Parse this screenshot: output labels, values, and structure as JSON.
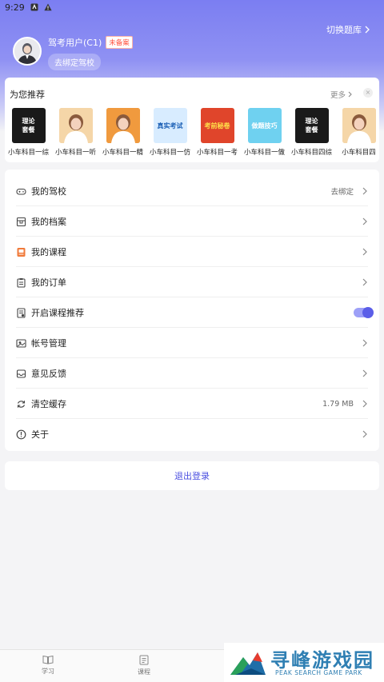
{
  "status_bar": {
    "time": "9:29"
  },
  "header": {
    "switch_bank_label": "切换题库",
    "user_name": "驾考用户(C1)",
    "badge": "未备案",
    "bind_school_label": "去绑定驾校"
  },
  "recommend": {
    "title": "为您推荐",
    "more_label": "更多",
    "close_label": "×",
    "items": [
      {
        "label": "小车科目一综",
        "thumb_text": "理论\n套餐",
        "bg": "#1a1a1a",
        "fg": "#ffffff"
      },
      {
        "label": "小车科目一听",
        "thumb_text": "",
        "bg": "#f5d6a8",
        "fg": "#ffffff"
      },
      {
        "label": "小车科目一精",
        "thumb_text": "",
        "bg": "#f09a3e",
        "fg": "#ffffff"
      },
      {
        "label": "小车科目一仿",
        "thumb_text": "真实考试",
        "bg": "#d8ecff",
        "fg": "#1b5fb5"
      },
      {
        "label": "小车科目一考",
        "thumb_text": "考前秘卷",
        "bg": "#e0452b",
        "fg": "#ffe14a"
      },
      {
        "label": "小车科目一做",
        "thumb_text": "做题技巧",
        "bg": "#6fd1f0",
        "fg": "#ffffff"
      },
      {
        "label": "小车科目四综",
        "thumb_text": "理论\n套餐",
        "bg": "#1a1a1a",
        "fg": "#ffffff"
      },
      {
        "label": "小车科目四",
        "thumb_text": "",
        "bg": "#f5d6a8",
        "fg": "#ffffff"
      }
    ]
  },
  "menu": [
    {
      "label": "我的驾校",
      "value": "去绑定",
      "icon": "gamepad-icon",
      "kind": "chevron"
    },
    {
      "label": "我的档案",
      "value": "",
      "icon": "archive-box-icon",
      "kind": "chevron"
    },
    {
      "label": "我的课程",
      "value": "",
      "icon": "course-book-icon",
      "kind": "chevron"
    },
    {
      "label": "我的订单",
      "value": "",
      "icon": "clipboard-icon",
      "kind": "chevron"
    },
    {
      "label": "开启课程推荐",
      "value": "",
      "icon": "recommend-doc-icon",
      "kind": "toggle",
      "on": true
    },
    {
      "label": "帐号管理",
      "value": "",
      "icon": "account-image-icon",
      "kind": "chevron"
    },
    {
      "label": "意见反馈",
      "value": "",
      "icon": "inbox-icon",
      "kind": "chevron"
    },
    {
      "label": "清空缓存",
      "value": "1.79 MB",
      "icon": "refresh-icon",
      "kind": "chevron"
    },
    {
      "label": "关于",
      "value": "",
      "icon": "info-circle-icon",
      "kind": "chevron"
    }
  ],
  "logout_label": "退出登录",
  "tabs": [
    {
      "label": "学习",
      "icon": "open-book-icon"
    },
    {
      "label": "课程",
      "icon": "document-icon"
    }
  ],
  "watermark": {
    "title": "寻峰游戏园",
    "subtitle": "PEAK SEARCH GAME PARK"
  },
  "colors": {
    "accent": "#5b5ee8",
    "header": "#7b7ef2",
    "badge": "#ff4d3a",
    "watermark": "#2f7fb3"
  }
}
